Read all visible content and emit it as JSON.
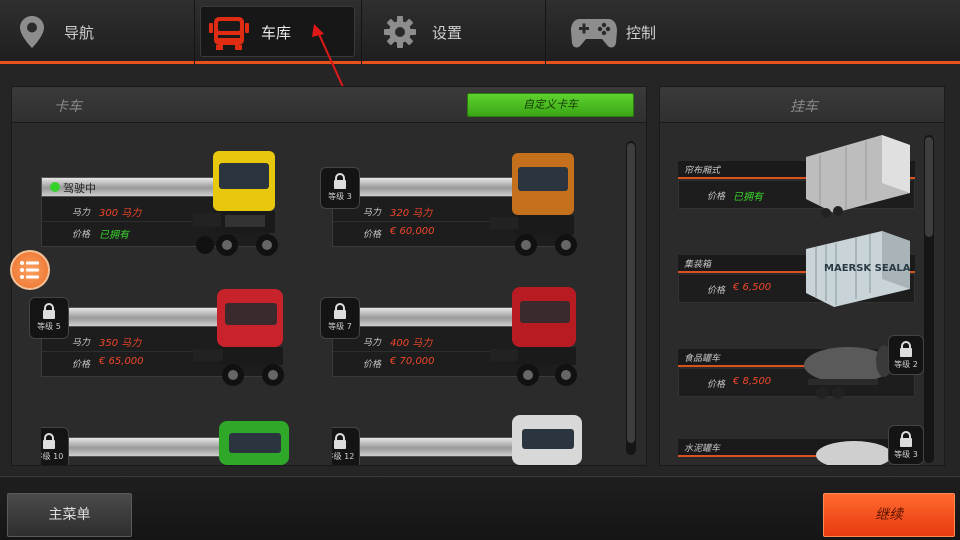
{
  "nav": {
    "tabs": [
      {
        "label": "导航",
        "icon": "map-pin-icon"
      },
      {
        "label": "车库",
        "icon": "truck-front-icon",
        "active": true
      },
      {
        "label": "设置",
        "icon": "gear-icon"
      },
      {
        "label": "控制",
        "icon": "gamepad-icon"
      }
    ]
  },
  "trucks_panel": {
    "title": "卡车",
    "custom_button": "自定义卡车",
    "cards": [
      {
        "status": "驾驶中",
        "hp_label": "马力",
        "hp": "300 马力",
        "price_label": "价格",
        "price": "已拥有",
        "locked": false,
        "truck_color": "#e8c80e"
      },
      {
        "level": "等级 3",
        "hp_label": "马力",
        "hp": "320 马力",
        "price_label": "价格",
        "price": "€ 60,000",
        "locked": true,
        "truck_color": "#c4701c"
      },
      {
        "level": "等级 5",
        "hp_label": "马力",
        "hp": "350 马力",
        "price_label": "价格",
        "price": "€ 65,000",
        "locked": true,
        "truck_color": "#c8222a"
      },
      {
        "level": "等级 7",
        "hp_label": "马力",
        "hp": "400 马力",
        "price_label": "价格",
        "price": "€ 70,000",
        "locked": true,
        "truck_color": "#b81c22"
      },
      {
        "level": "等级 10",
        "locked": true,
        "truck_color": "#2fa82a"
      },
      {
        "level": "等级 12",
        "locked": true,
        "truck_color": "#d8d8d8"
      }
    ]
  },
  "trailers_panel": {
    "title": "挂车",
    "cards": [
      {
        "name": "帘布厢式",
        "price_label": "价格",
        "price": "已拥有",
        "owned": true
      },
      {
        "name": "集装箱",
        "price_label": "价格",
        "price": "€ 6,500",
        "owned": false
      },
      {
        "name": "食品罐车",
        "price_label": "价格",
        "price": "€ 8,500",
        "owned": false,
        "level": "等级 2"
      },
      {
        "name": "水泥罐车",
        "level": "等级 3"
      }
    ],
    "container_text": "MAERSK SEALAND"
  },
  "footer": {
    "main_menu": "主菜单",
    "continue": "继续"
  },
  "colors": {
    "accent": "#e8521c",
    "owned_green": "#39d42a",
    "price_red": "#f0462a"
  }
}
